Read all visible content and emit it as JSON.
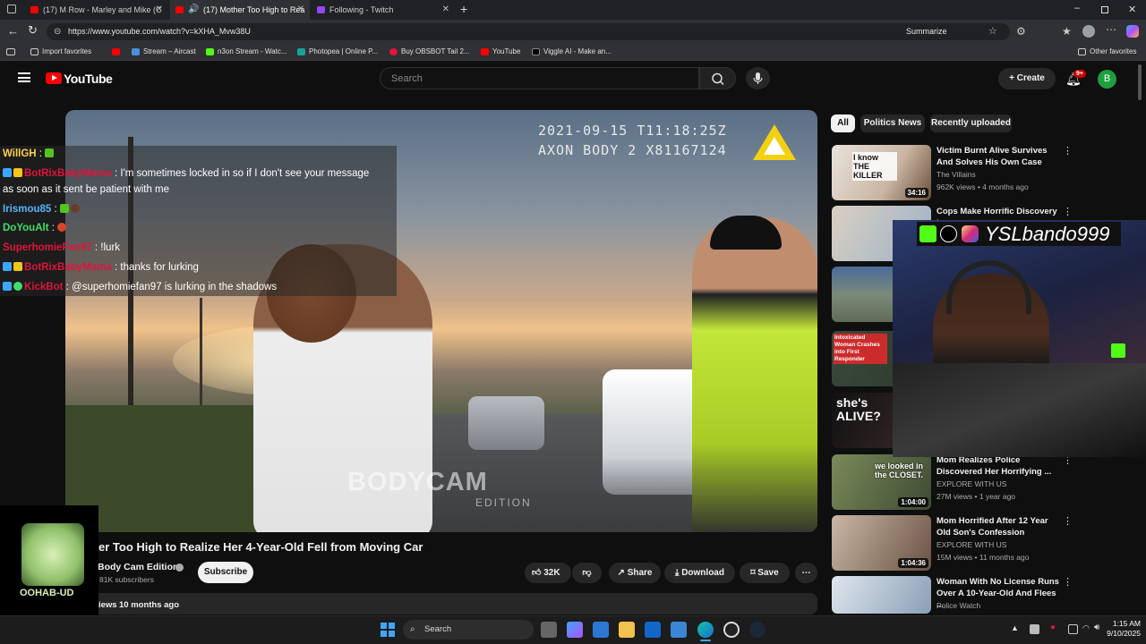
{
  "tabs": [
    {
      "label": "(17) M Row - Marley and Mike (C",
      "favicon_color": "#ff0000"
    },
    {
      "label": "(17) Mother Too High to Rea",
      "favicon_color": "#ff0000"
    },
    {
      "label": "Following - Twitch",
      "favicon_color": "#9146ff"
    }
  ],
  "url": "https://www.youtube.com/watch?v=kXHA_Mvw38U",
  "summarize_label": "Summarize",
  "bookmarks": [
    "Import favorites",
    "",
    "Stream – Aircast",
    "n3on Stream - Watc...",
    "Photopea | Online P...",
    "Buy OBSBOT Tail 2...",
    "YouTube",
    "Viggle AI - Make an..."
  ],
  "other_favorites": "Other favorites",
  "youtube": {
    "logo": "YouTube",
    "search_placeholder": "Search",
    "create_label": "Create",
    "notif_count": "9+",
    "avatar_letter": "B"
  },
  "video": {
    "timestamp": "2021-09-15 T11:18:25Z",
    "device": "AXON BODY 2 X81167124",
    "watermark": "BODYCAM",
    "watermark_sub": "EDITION",
    "title": "er Too High to Realize Her 4-Year-Old Fell from Moving Car",
    "channel": "Body Cam Edition",
    "subscribers": "81K subscribers",
    "subscribe_label": "Subscribe",
    "likes": "32K",
    "share_label": "Share",
    "download_label": "Download",
    "save_label": "Save",
    "views_label": "iews",
    "age": "10 months ago"
  },
  "chat": [
    {
      "name": "WillGH",
      "color": "#ffd24a",
      "msg": "",
      "badges": 0
    },
    {
      "name": "BotRixBabyMama",
      "color": "#e0143c",
      "msg": "I'm sometimes locked in so if I don't see your message",
      "badges": 2
    },
    {
      "name": "",
      "color": "#fff",
      "msg": "as soon as it sent be patient with me",
      "badges": 0
    },
    {
      "name": "Irismou85",
      "color": "#53b5ff",
      "msg": "",
      "badges": 0
    },
    {
      "name": "DoYouAlt",
      "color": "#3fdd6a",
      "msg": "",
      "badges": 0
    },
    {
      "name": "SuperhomieFan97",
      "color": "#e0143c",
      "msg": "!lurk",
      "badges": 0
    },
    {
      "name": "BotRixBabyMama",
      "color": "#e0143c",
      "msg": "thanks for lurking",
      "badges": 2
    },
    {
      "name": "KickBot",
      "color": "#e0143c",
      "msg": "@superhomiefan97 is lurking in the shadows",
      "badges": 2
    }
  ],
  "chips": [
    "All",
    "Politics News",
    "Recently uploaded"
  ],
  "recommendations": [
    {
      "title": "Victim Burnt Alive Survives And Solves His Own Case",
      "channel": "The Villains",
      "meta": "962K views • 4 months ago",
      "duration": "34:16",
      "thumb_text": "I know THE KILLER"
    },
    {
      "title": "Cops Make Horrific Discovery in",
      "channel": "",
      "meta": "",
      "duration": "",
      "thumb_text": ""
    },
    {
      "title": "",
      "channel": "",
      "meta": "",
      "duration": "",
      "thumb_text": ""
    },
    {
      "title": "",
      "channel": "",
      "meta": "",
      "duration": "",
      "thumb_text": "Intoxicated Woman Crashes into First Responder"
    },
    {
      "title": "",
      "channel": "",
      "meta": "",
      "duration": "",
      "thumb_text": "she's ALIVE?"
    },
    {
      "title": "Mom Realizes Police Discovered Her Horrifying ...",
      "channel": "EXPLORE WITH US",
      "meta": "27M views • 1 year ago",
      "duration": "1:04:00",
      "thumb_text": "we looked in the CLOSET."
    },
    {
      "title": "Mom Horrified After 12 Year Old Son's Confession",
      "channel": "EXPLORE WITH US",
      "meta": "15M views • 11 months ago",
      "duration": "1:04:36",
      "thumb_text": ""
    },
    {
      "title": "Woman With No License Runs Over A 10-Year-Old And Flees ...",
      "channel": "Police Watch",
      "meta": "",
      "duration": "",
      "thumb_text": ""
    }
  ],
  "webcam": {
    "handle": "YSLbando999"
  },
  "logo_overlay": "OOHAB-UD",
  "taskbar": {
    "search_placeholder": "Search",
    "time": "1:15 AM",
    "date": "9/10/2025"
  },
  "colors": {
    "youtube_red": "#ff0000",
    "accent_blue": "#3ea6ff",
    "avatar_green": "#1e9e3e"
  }
}
